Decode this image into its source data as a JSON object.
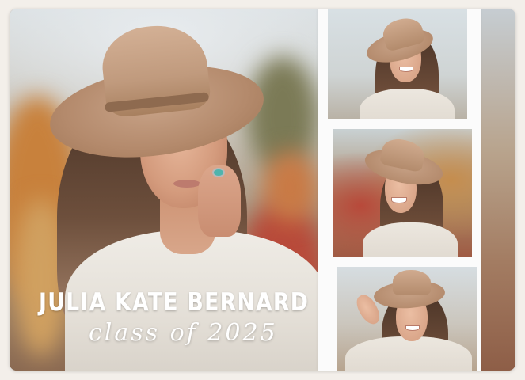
{
  "card": {
    "name": "JULIA KATE BERNARD",
    "script_line": "class of 2025"
  },
  "colors": {
    "text": "#ffffff",
    "strip_border": "#fbfbfb",
    "hat": "#c09a7d",
    "sweater": "#e6e1d9"
  },
  "photos": {
    "main": "portrait-hat-hand-on-cheek",
    "strip": [
      "portrait-smiling-hat",
      "portrait-laughing-hat",
      "portrait-hand-on-hat"
    ]
  }
}
